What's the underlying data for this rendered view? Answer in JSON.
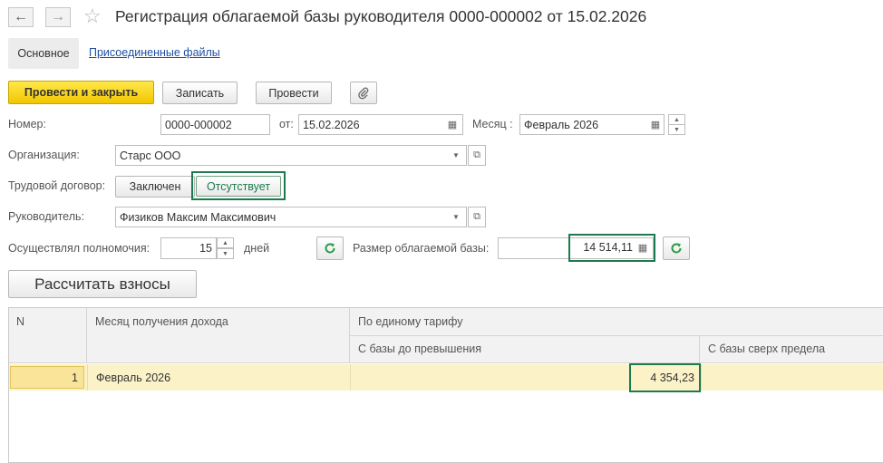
{
  "window": {
    "title": "Регистрация облагаемой базы руководителя 0000-000002 от 15.02.2026"
  },
  "nav": {
    "back_icon": "arrow-left-icon",
    "forward_icon": "arrow-right-icon",
    "favorite_icon": "star-icon"
  },
  "tabs": {
    "main_label": "Основное",
    "files_label": "Присоединенные файлы"
  },
  "toolbar": {
    "post_close_label": "Провести и закрыть",
    "save_label": "Записать",
    "post_label": "Провести",
    "attach_icon": "paperclip-icon"
  },
  "form": {
    "number_label": "Номер:",
    "number_value": "0000-000002",
    "date_label": "от:",
    "date_value": "15.02.2026",
    "month_label": "Месяц :",
    "month_value": "Февраль 2026",
    "org_label": "Организация:",
    "org_value": "Старс ООО",
    "contract_label": "Трудовой договор:",
    "contract_opt1": "Заключен",
    "contract_opt2": "Отсутствует",
    "head_label": "Руководитель:",
    "head_value": "Физиков Максим Максимович",
    "powers_label": "Осуществлял полномочия:",
    "powers_value": "15",
    "days_label": "дней",
    "base_label": "Размер облагаемой базы:",
    "base_value": "14 514,11"
  },
  "calc": {
    "button_label": "Рассчитать взносы"
  },
  "table": {
    "col_n": "N",
    "col_month": "Месяц получения дохода",
    "col_group": "По единому тарифу",
    "col_below": "С базы до превышения",
    "col_above": "С базы сверх предела",
    "rows": [
      {
        "n": "1",
        "month": "Февраль 2026",
        "below": "4 354,23",
        "above": ""
      }
    ]
  },
  "colors": {
    "accent_yellow": "#f2c600",
    "highlight_green": "#1b7b4e",
    "link_blue": "#1f4fa3",
    "row_selected": "#fbf2c8"
  }
}
